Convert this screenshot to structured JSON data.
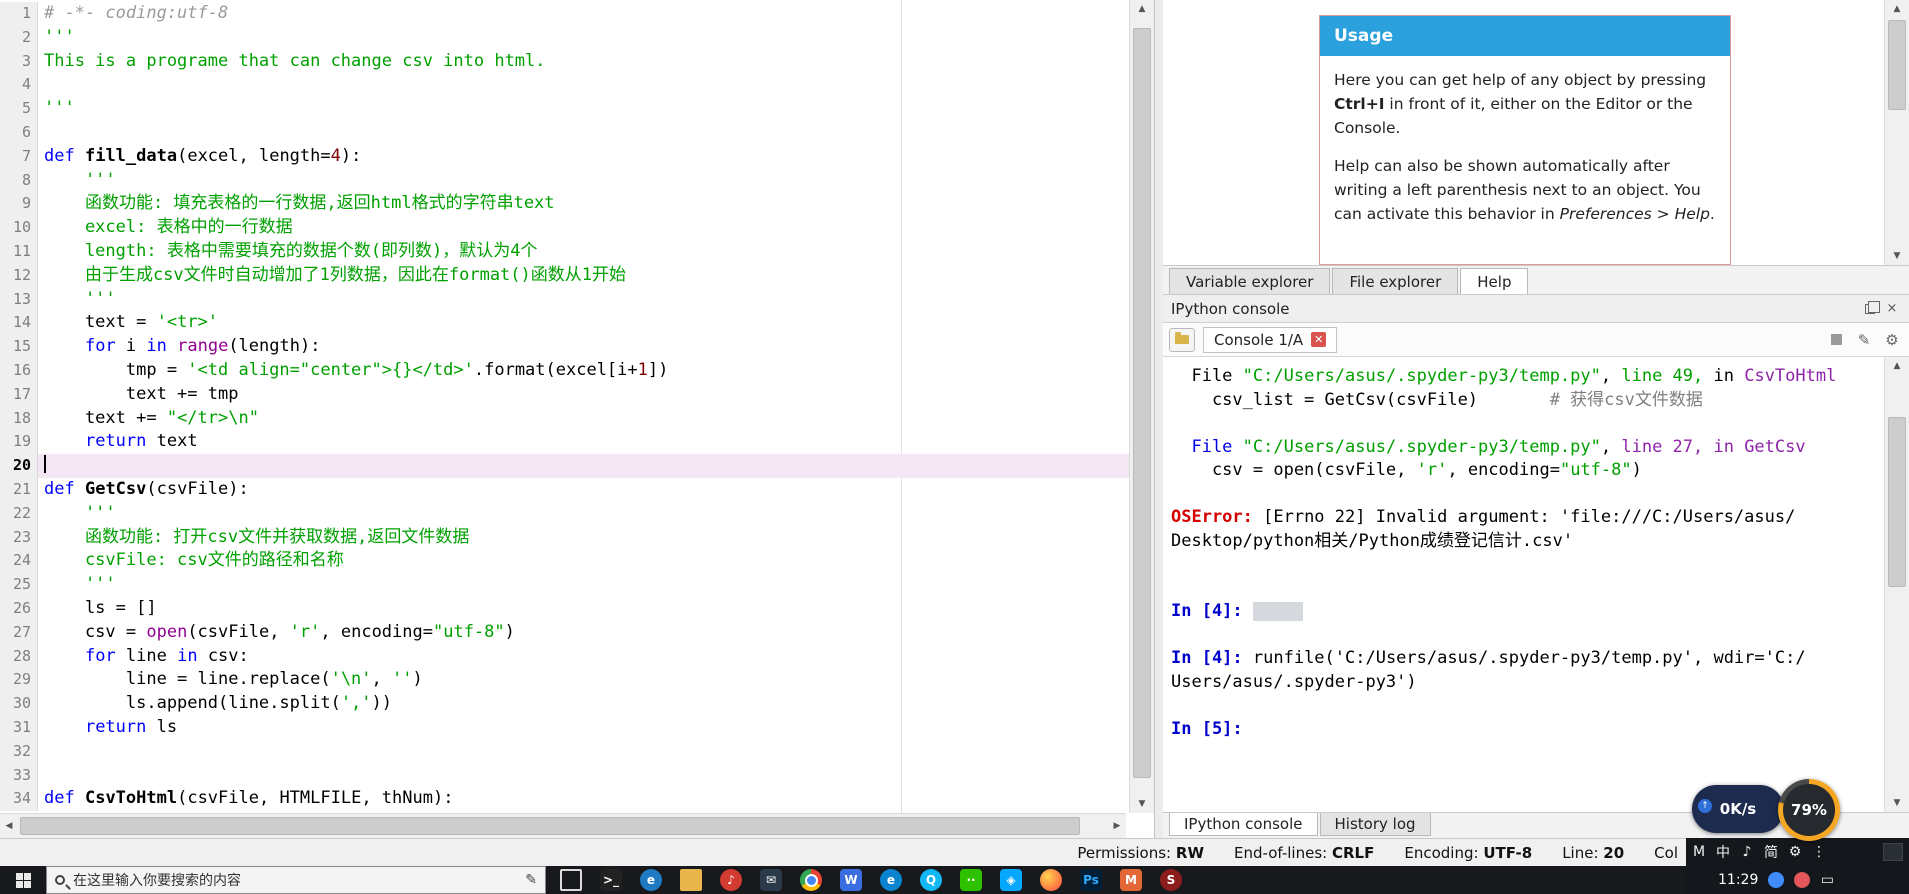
{
  "editor": {
    "lines": [
      {
        "n": 1,
        "tokens": [
          [
            "c",
            "# -*- coding:utf-8"
          ]
        ]
      },
      {
        "n": 2,
        "tokens": [
          [
            "s",
            "'''"
          ]
        ]
      },
      {
        "n": 3,
        "tokens": [
          [
            "s",
            "This is a programe that can change csv into html."
          ]
        ]
      },
      {
        "n": 4,
        "tokens": []
      },
      {
        "n": 5,
        "tokens": [
          [
            "s",
            "'''"
          ]
        ]
      },
      {
        "n": 6,
        "tokens": []
      },
      {
        "n": 7,
        "tokens": [
          [
            "k",
            "def"
          ],
          [
            "t",
            " "
          ],
          [
            "d",
            "fill_data"
          ],
          [
            "t",
            "(excel, length="
          ],
          [
            "n",
            "4"
          ],
          [
            "t",
            "):"
          ]
        ]
      },
      {
        "n": 8,
        "tokens": [
          [
            "s",
            "    '''"
          ]
        ]
      },
      {
        "n": 9,
        "tokens": [
          [
            "s",
            "    函数功能: 填充表格的一行数据,返回html格式的字符串text"
          ]
        ]
      },
      {
        "n": 10,
        "tokens": [
          [
            "s",
            "    excel: 表格中的一行数据"
          ]
        ]
      },
      {
        "n": 11,
        "tokens": [
          [
            "s",
            "    length: 表格中需要填充的数据个数(即列数)，默认为4个"
          ]
        ]
      },
      {
        "n": 12,
        "tokens": [
          [
            "s",
            "    由于生成csv文件时自动增加了1列数据，因此在format()函数从1开始"
          ]
        ]
      },
      {
        "n": 13,
        "tokens": [
          [
            "s",
            "    '''"
          ]
        ]
      },
      {
        "n": 14,
        "tokens": [
          [
            "t",
            "    text = "
          ],
          [
            "s",
            "'<tr>'"
          ]
        ]
      },
      {
        "n": 15,
        "tokens": [
          [
            "t",
            "    "
          ],
          [
            "k",
            "for"
          ],
          [
            "t",
            " i "
          ],
          [
            "k",
            "in"
          ],
          [
            "t",
            " "
          ],
          [
            "b",
            "range"
          ],
          [
            "t",
            "(length):"
          ]
        ]
      },
      {
        "n": 16,
        "tokens": [
          [
            "t",
            "        tmp = "
          ],
          [
            "s",
            "'<td align=\"center\">{}</td>'"
          ],
          [
            "t",
            ".format(excel[i+"
          ],
          [
            "n",
            "1"
          ],
          [
            "t",
            "])"
          ]
        ]
      },
      {
        "n": 17,
        "tokens": [
          [
            "t",
            "        text += tmp"
          ]
        ]
      },
      {
        "n": 18,
        "tokens": [
          [
            "t",
            "    text += "
          ],
          [
            "s",
            "\"</tr>\\n\""
          ]
        ]
      },
      {
        "n": 19,
        "tokens": [
          [
            "t",
            "    "
          ],
          [
            "k",
            "return"
          ],
          [
            "t",
            " text"
          ]
        ]
      },
      {
        "n": 20,
        "tokens": [],
        "current": true
      },
      {
        "n": 21,
        "tokens": [
          [
            "k",
            "def"
          ],
          [
            "t",
            " "
          ],
          [
            "d",
            "GetCsv"
          ],
          [
            "t",
            "(csvFile):"
          ]
        ]
      },
      {
        "n": 22,
        "tokens": [
          [
            "s",
            "    '''"
          ]
        ]
      },
      {
        "n": 23,
        "tokens": [
          [
            "s",
            "    函数功能: 打开csv文件并获取数据,返回文件数据"
          ]
        ]
      },
      {
        "n": 24,
        "tokens": [
          [
            "s",
            "    csvFile: csv文件的路径和名称"
          ]
        ]
      },
      {
        "n": 25,
        "tokens": [
          [
            "s",
            "    '''"
          ]
        ]
      },
      {
        "n": 26,
        "tokens": [
          [
            "t",
            "    ls = []"
          ]
        ]
      },
      {
        "n": 27,
        "tokens": [
          [
            "t",
            "    csv = "
          ],
          [
            "b",
            "open"
          ],
          [
            "t",
            "(csvFile, "
          ],
          [
            "s",
            "'r'"
          ],
          [
            "t",
            ", encoding="
          ],
          [
            "s",
            "\"utf-8\""
          ],
          [
            "t",
            ")"
          ]
        ]
      },
      {
        "n": 28,
        "tokens": [
          [
            "t",
            "    "
          ],
          [
            "k",
            "for"
          ],
          [
            "t",
            " line "
          ],
          [
            "k",
            "in"
          ],
          [
            "t",
            " csv:"
          ]
        ]
      },
      {
        "n": 29,
        "tokens": [
          [
            "t",
            "        line = line.replace("
          ],
          [
            "s",
            "'\\n'"
          ],
          [
            "t",
            ", "
          ],
          [
            "s",
            "''"
          ],
          [
            "t",
            ")"
          ]
        ]
      },
      {
        "n": 30,
        "tokens": [
          [
            "t",
            "        ls.append(line.split("
          ],
          [
            "s",
            "','"
          ],
          [
            "t",
            "))"
          ]
        ]
      },
      {
        "n": 31,
        "tokens": [
          [
            "t",
            "    "
          ],
          [
            "k",
            "return"
          ],
          [
            "t",
            " ls"
          ]
        ]
      },
      {
        "n": 32,
        "tokens": []
      },
      {
        "n": 33,
        "tokens": []
      },
      {
        "n": 34,
        "tokens": [
          [
            "k",
            "def"
          ],
          [
            "t",
            " "
          ],
          [
            "d",
            "CsvToHtml"
          ],
          [
            "t",
            "(csvFile, HTMLFILE, thNum):"
          ]
        ]
      }
    ]
  },
  "help": {
    "usage_title": "Usage",
    "paragraphs": [
      [
        [
          "t",
          "Here you can get help of any object by pressing "
        ],
        [
          "b",
          "Ctrl+I"
        ],
        [
          "t",
          " in front of it, either on the Editor or the Console."
        ]
      ],
      [
        [
          "t",
          "Help can also be shown automatically after writing a left parenthesis next to an object. You can activate this behavior in "
        ],
        [
          "i",
          "Preferences > Help"
        ],
        [
          "t",
          "."
        ]
      ]
    ],
    "tabs": [
      {
        "label": "Variable explorer"
      },
      {
        "label": "File explorer"
      },
      {
        "label": "Help"
      }
    ]
  },
  "console": {
    "title": "IPython console",
    "tab_label": "Console 1/A",
    "lines": [
      [
        [
          "pl",
          "  File "
        ],
        [
          "g",
          "\"C:/Users/asus/.spyder-py3/temp.py\""
        ],
        [
          "pl",
          ", "
        ],
        [
          "g",
          "line 49,"
        ],
        [
          "pl",
          " in "
        ],
        [
          "m",
          "CsvToHtml"
        ]
      ],
      [
        [
          "pl",
          "    csv_list = GetCsv(csvFile)       "
        ],
        [
          "cm",
          "# 获得csv文件数据"
        ]
      ],
      [],
      [
        [
          "fb",
          "  File "
        ],
        [
          "g",
          "\"C:/Users/asus/.spyder-py3/temp.py\""
        ],
        [
          "pl",
          ", "
        ],
        [
          "m",
          "line 27, in GetCsv"
        ]
      ],
      [
        [
          "pl",
          "    csv = open(csvFile, "
        ],
        [
          "g",
          "'r'"
        ],
        [
          "pl",
          ", encoding="
        ],
        [
          "g",
          "\"utf-8\""
        ],
        [
          "pl",
          ")"
        ]
      ],
      [],
      [
        [
          "er",
          "OSError:"
        ],
        [
          "pl",
          " [Errno 22] Invalid argument: 'file:///C:/Users/asus/"
        ]
      ],
      [
        [
          "pl",
          "Desktop/python相关/Python成绩登记信计.csv'"
        ]
      ],
      [],
      [],
      [
        [
          "pr",
          "In [4]: "
        ],
        [
          "sel",
          ""
        ]
      ],
      [],
      [
        [
          "pr",
          "In [4]: "
        ],
        [
          "pl",
          "runfile('C:/Users/asus/.spyder-py3/temp.py', wdir='C:/"
        ]
      ],
      [
        [
          "pl",
          "Users/asus/.spyder-py3')"
        ]
      ],
      [],
      [
        [
          "pr",
          "In [5]: "
        ]
      ]
    ],
    "bottom_tabs": [
      {
        "label": "IPython console"
      },
      {
        "label": "History log"
      }
    ]
  },
  "statusbar": {
    "permissions_label": "Permissions:",
    "permissions": "RW",
    "eol_label": "End-of-lines:",
    "eol": "CRLF",
    "encoding_label": "Encoding:",
    "encoding": "UTF-8",
    "line_label": "Line:",
    "line": "20",
    "col_label": "Col"
  },
  "tray": {
    "ime_icons": [
      "M",
      "中",
      "♪",
      "简"
    ],
    "time": "11:29"
  },
  "taskbar": {
    "search_placeholder": "在这里输入你要搜索的内容",
    "apps": [
      {
        "name": "task-view-icon",
        "glyph": "",
        "shape": "outline"
      },
      {
        "name": "cmd-icon",
        "glyph": ">_",
        "bg": "#222222"
      },
      {
        "name": "ie-icon",
        "glyph": "e",
        "bg": "#1f7ac4",
        "shape": "circle"
      },
      {
        "name": "folder-icon",
        "glyph": "",
        "shape": "folder"
      },
      {
        "name": "netease-music-icon",
        "glyph": "♪",
        "bg": "#d33a31",
        "shape": "circle"
      },
      {
        "name": "foxmail-icon",
        "glyph": "✉",
        "bg": "#2b3a4a"
      },
      {
        "name": "chrome-icon",
        "glyph": "",
        "shape": "chrome"
      },
      {
        "name": "wps-icon",
        "glyph": "W",
        "bg": "#3a6de0"
      },
      {
        "name": "edge-icon",
        "glyph": "e",
        "bg": "#0a84d0",
        "shape": "circle"
      },
      {
        "name": "qq-icon",
        "glyph": "Q",
        "bg": "#12b7f5",
        "shape": "circle"
      },
      {
        "name": "wechat-icon",
        "glyph": "··",
        "bg": "#2dc100"
      },
      {
        "name": "baidu-netdisk-icon",
        "glyph": "◈",
        "bg": "#06a7ff"
      },
      {
        "name": "firefox-icon",
        "glyph": "",
        "shape": "firefox"
      },
      {
        "name": "photoshop-icon",
        "glyph": "Ps",
        "bg": "#001e36",
        "fg": "#31a8ff"
      },
      {
        "name": "matlab-icon",
        "glyph": "M",
        "bg": "#e16737"
      },
      {
        "name": "spyder-icon",
        "glyph": "S",
        "bg": "#8c1d1d",
        "shape": "circle"
      }
    ]
  },
  "widget": {
    "speed": "0K/s",
    "battery": "79%"
  }
}
